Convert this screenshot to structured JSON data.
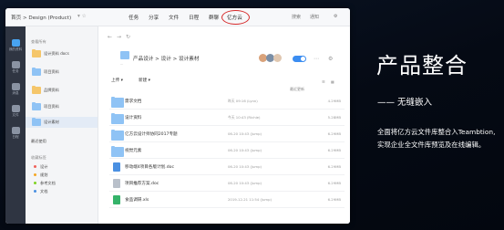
{
  "window": {
    "breadcrumb": "首页 > Design (Product)",
    "breadcrumb_tail": "▾ ☆",
    "nav": [
      "任务",
      "分享",
      "文件",
      "日程",
      "群聊",
      "亿方云"
    ],
    "right_actions": [
      "搜索",
      "通知",
      "⚙"
    ]
  },
  "rail": [
    {
      "label": "我的资料",
      "active": true
    },
    {
      "label": "任务",
      "active": false
    },
    {
      "label": "消息",
      "active": false
    },
    {
      "label": "文件",
      "active": false
    },
    {
      "label": "日程",
      "active": false
    }
  ],
  "sidebar": {
    "section1": "查看所有",
    "items": [
      {
        "label": "设计资料 docs"
      },
      {
        "label": "项目资料"
      },
      {
        "label": "品牌资料"
      },
      {
        "label": "项目资料"
      },
      {
        "label": "设计素材"
      }
    ],
    "recent": "最近使用",
    "section2": "收藏标签",
    "tags": [
      {
        "label": "设计",
        "color": "#f0625a"
      },
      {
        "label": "规划",
        "color": "#f5a623"
      },
      {
        "label": "参考文档",
        "color": "#7ed321"
      },
      {
        "label": "文档",
        "color": "#4a90e2"
      }
    ]
  },
  "main": {
    "path": "产品设计 > 设计 > 设计素材",
    "path_sub": "···",
    "upload_label": "上传 ▾",
    "new_label": "新建 ▾",
    "sort_label": "最近更新",
    "files": [
      {
        "name": "需求文档",
        "date": "昨天 09:16 (Lynn)",
        "size": "4.29MB",
        "icon": "folder"
      },
      {
        "name": "设计资料",
        "date": "今天 10:43 (Richie)",
        "size": "5.28MB",
        "icon": "folder"
      },
      {
        "name": "亿方云设计师协同2017专题",
        "date": "06-20 10:43 (Jump)",
        "size": "6.29MB",
        "icon": "folder"
      },
      {
        "name": "视觉元素",
        "date": "06-20 10:43 (Jump)",
        "size": "6.29MB",
        "icon": "folder"
      },
      {
        "name": "移动端4项目各版计划.doc",
        "date": "06-20 10:43 (Jump)",
        "size": "6.29MB",
        "icon": "doc"
      },
      {
        "name": "项目推荐方案.doc",
        "date": "06-20 10:43 (Jump)",
        "size": "6.29MB",
        "icon": "doc"
      },
      {
        "name": "食品调研.xls",
        "date": "2019-12-21 11:54 (Jump)",
        "size": "6.29MB",
        "icon": "xls"
      }
    ]
  },
  "panel": {
    "title": "产品整合",
    "subtitle": "—— 无缝嵌入",
    "body": "全面将亿方云文件库整合入Teambtion, 实现企业全文件库预览及在线编辑。"
  }
}
